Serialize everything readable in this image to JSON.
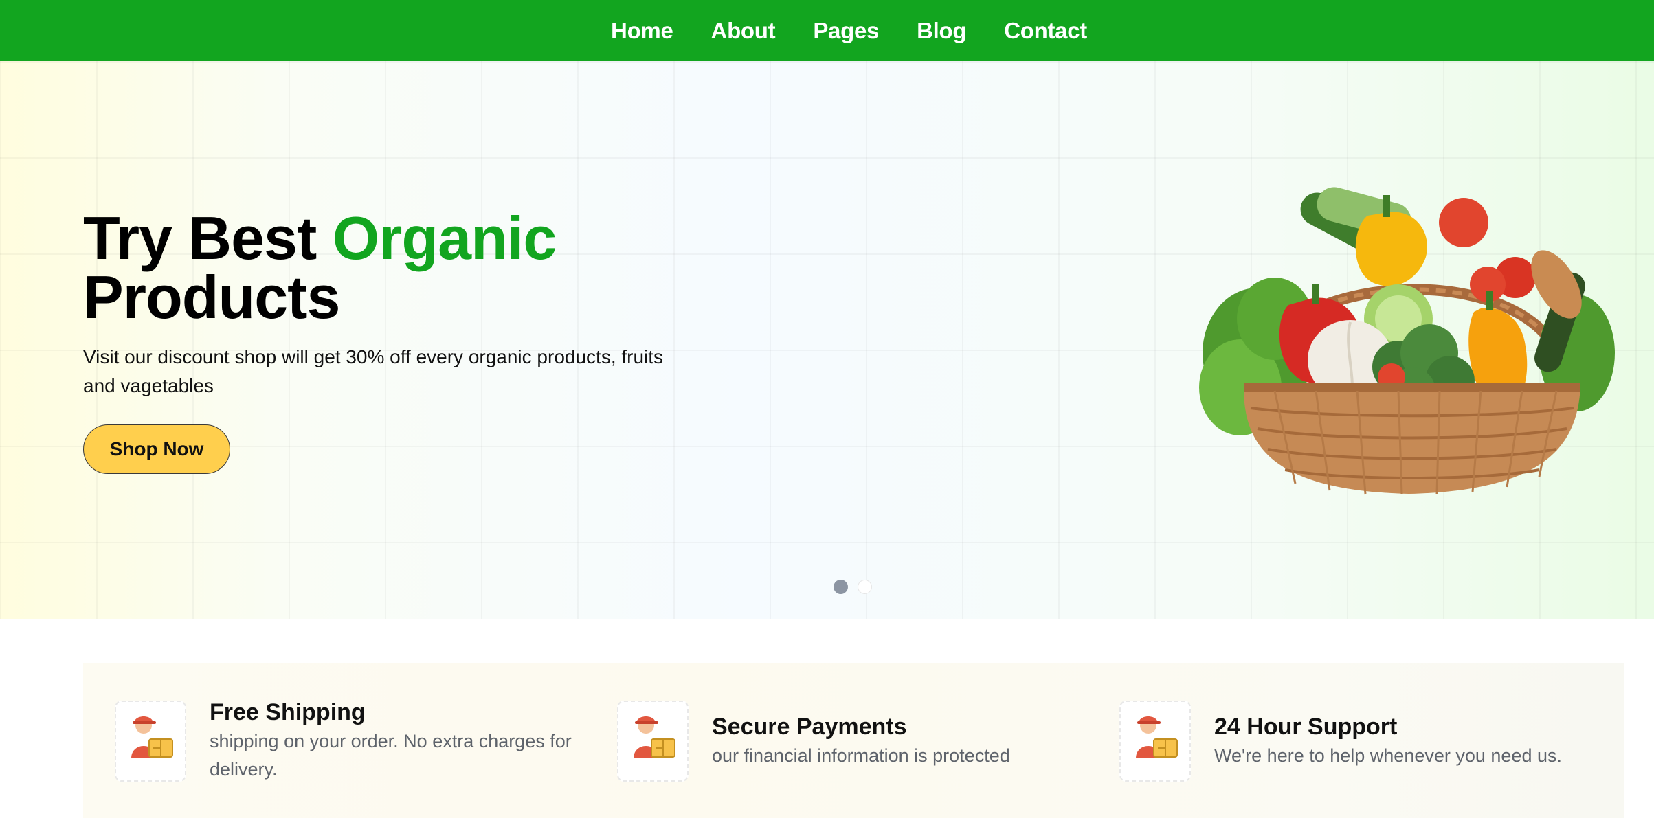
{
  "nav": {
    "items": [
      {
        "label": "Home"
      },
      {
        "label": "About"
      },
      {
        "label": "Pages"
      },
      {
        "label": "Blog"
      },
      {
        "label": "Contact"
      }
    ]
  },
  "hero": {
    "title_part1": "Try Best ",
    "title_accent": "Organic",
    "title_part2": "Products",
    "subtitle": "Visit our discount shop will get 30% off every organic products, fruits and vagetables",
    "cta_label": "Shop Now",
    "slides": {
      "count": 2,
      "active_index": 0
    },
    "image_icon": "vegetable-basket"
  },
  "features": [
    {
      "icon": "delivery-person-icon",
      "title": "Free Shipping",
      "description": "shipping on your order. No extra charges for delivery."
    },
    {
      "icon": "delivery-person-icon",
      "title": "Secure Payments",
      "description": "our financial information is protected"
    },
    {
      "icon": "delivery-person-icon",
      "title": "24 Hour Support",
      "description": "We're here to help whenever you need us."
    }
  ],
  "colors": {
    "brand_green": "#12a51f",
    "cta_yellow": "#ffcf4d",
    "muted_text": "#5e636b"
  }
}
